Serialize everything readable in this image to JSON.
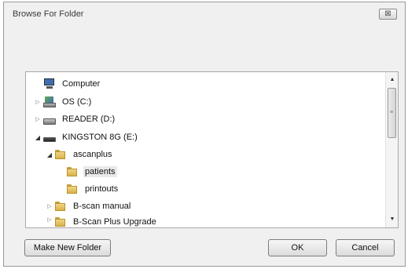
{
  "dialog": {
    "title": "Browse For Folder",
    "close_glyph": "⊠"
  },
  "tree": {
    "items": [
      {
        "label": "Computer",
        "icon": "computer-icon",
        "expander": ""
      },
      {
        "label": "OS (C:)",
        "icon": "hard-drive-icon",
        "expander": "▷"
      },
      {
        "label": "READER (D:)",
        "icon": "drive-icon",
        "expander": "▷"
      },
      {
        "label": "KINGSTON 8G (E:)",
        "icon": "usb-drive-icon",
        "expander": "◢"
      },
      {
        "label": "ascanplus",
        "icon": "folder-icon",
        "expander": "◢"
      },
      {
        "label": "patients",
        "icon": "folder-icon",
        "expander": ""
      },
      {
        "label": "printouts",
        "icon": "folder-icon",
        "expander": ""
      },
      {
        "label": "B-scan manual",
        "icon": "folder-icon",
        "expander": "▷"
      },
      {
        "label": "B-Scan Plus Upgrade",
        "icon": "folder-icon",
        "expander": "▷"
      }
    ],
    "selected_item": "patients"
  },
  "scrollbar": {
    "up_arrow": "▲",
    "down_arrow": "▼",
    "grip": "≡"
  },
  "buttons": {
    "make_new_folder": "Make New Folder",
    "ok": "OK",
    "cancel": "Cancel"
  }
}
